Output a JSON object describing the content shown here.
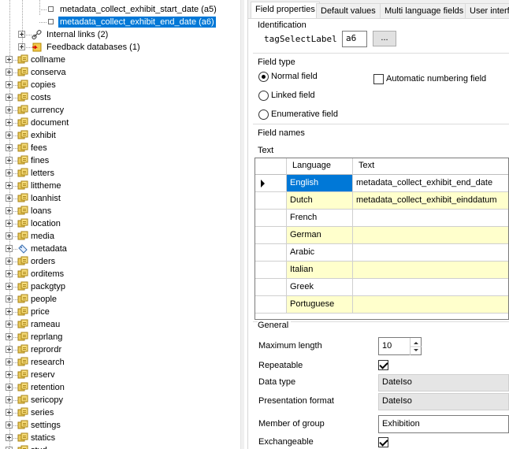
{
  "tree": {
    "children_top": [
      {
        "label": "metadata_collect_exhibit_start_date (a5)",
        "selected": false
      },
      {
        "label": "metadata_collect_exhibit_end_date (a6)",
        "selected": true
      }
    ],
    "sub_nodes": [
      {
        "label": "Internal links (2)",
        "icon": "link-icon"
      },
      {
        "label": "Feedback databases (1)",
        "icon": "feedback-database-icon"
      }
    ],
    "databases": [
      "collname",
      "conserva",
      "copies",
      "costs",
      "currency",
      "document",
      "exhibit",
      "fees",
      "fines",
      "letters",
      "littheme",
      "loanhist",
      "loans",
      "location",
      "media",
      "metadata",
      "orders",
      "orditems",
      "packgtyp",
      "people",
      "price",
      "rameau",
      "reprlang",
      "reprordr",
      "research",
      "reserv",
      "retention",
      "sericopy",
      "series",
      "settings",
      "statics",
      "stud"
    ],
    "special_icon_for": "metadata"
  },
  "tabs": [
    {
      "label": "Field properties",
      "active": true
    },
    {
      "label": "Default values",
      "active": false
    },
    {
      "label": "Multi language fields",
      "active": false
    },
    {
      "label": "User interfa",
      "active": false
    }
  ],
  "identification": {
    "title": "Identification",
    "tag_label": "tagSelectLabel",
    "tag_value": "a6",
    "browse_label": "..."
  },
  "field_type": {
    "title": "Field type",
    "options": [
      {
        "label": "Normal field",
        "selected": true
      },
      {
        "label": "Linked field",
        "selected": false
      },
      {
        "label": "Enumerative field",
        "selected": false
      }
    ],
    "auto_numbering_label": "Automatic numbering field",
    "auto_numbering_checked": false
  },
  "field_names": {
    "title": "Field names",
    "text_label": "Text",
    "columns": [
      "Language",
      "Text"
    ],
    "rows": [
      {
        "language": "English",
        "text": "metadata_collect_exhibit_end_date",
        "current": true
      },
      {
        "language": "Dutch",
        "text": "metadata_collect_exhibit_einddatum",
        "current": false
      },
      {
        "language": "French",
        "text": "",
        "current": false
      },
      {
        "language": "German",
        "text": "",
        "current": false
      },
      {
        "language": "Arabic",
        "text": "",
        "current": false
      },
      {
        "language": "Italian",
        "text": "",
        "current": false
      },
      {
        "language": "Greek",
        "text": "",
        "current": false
      },
      {
        "language": "Portuguese",
        "text": "",
        "current": false
      }
    ]
  },
  "general": {
    "title": "General",
    "max_length_label": "Maximum length",
    "max_length_value": "10",
    "repeatable_label": "Repeatable",
    "repeatable_checked": true,
    "data_type_label": "Data type",
    "data_type_value": "DateIso",
    "presentation_label": "Presentation format",
    "presentation_value": "DateIso",
    "member_label": "Member of group",
    "member_value": "Exhibition",
    "exchangeable_label": "Exchangeable",
    "exchangeable_checked": true
  },
  "colors": {
    "selection": "#0078d7",
    "grid_highlight": "#ffffcc",
    "panel_bg": "#f0f0f0"
  }
}
